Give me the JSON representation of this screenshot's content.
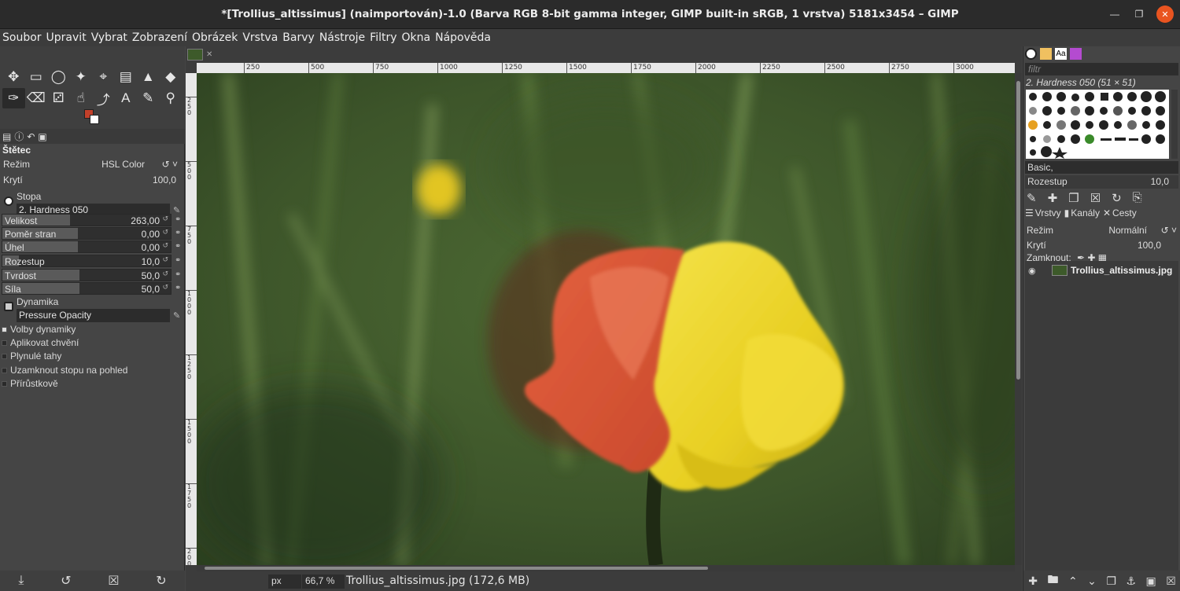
{
  "window": {
    "title": "*[Trollius_altissimus] (naimportován)-1.0 (Barva RGB 8-bit gamma integer, GIMP built-in sRGB, 1 vrstva) 5181x3454 – GIMP"
  },
  "menu": [
    "Soubor",
    "Upravit",
    "Vybrat",
    "Zobrazení",
    "Obrázek",
    "Vrstva",
    "Barvy",
    "Nástroje",
    "Filtry",
    "Okna",
    "Nápověda"
  ],
  "tool_options": {
    "title": "Štětec",
    "mode_label": "Režim",
    "mode_value": "HSL Color",
    "opacity_label": "Krytí",
    "opacity_value": "100,0",
    "brush_label": "Stopa",
    "brush_value": "2. Hardness 050",
    "sliders": [
      {
        "label": "Velikost",
        "value": "263,00",
        "fill": 0.4
      },
      {
        "label": "Poměr stran",
        "value": "0,00",
        "fill": 0.45
      },
      {
        "label": "Úhel",
        "value": "0,00",
        "fill": 0.45
      },
      {
        "label": "Rozestup",
        "value": "10,0",
        "fill": 0.1
      },
      {
        "label": "Tvrdost",
        "value": "50,0",
        "fill": 0.46
      },
      {
        "label": "Síla",
        "value": "50,0",
        "fill": 0.46
      }
    ],
    "dynamics_label": "Dynamika",
    "dynamics_value": "Pressure Opacity",
    "checks": [
      {
        "label": "Volby dynamiky",
        "on": true
      },
      {
        "label": "Aplikovat chvění",
        "on": false
      },
      {
        "label": "Plynulé tahy",
        "on": false
      },
      {
        "label": "Uzamknout stopu na pohled",
        "on": false
      },
      {
        "label": "Přírůstkově",
        "on": false
      }
    ]
  },
  "ruler": {
    "h_ticks": [
      "250",
      "500",
      "750",
      "1000",
      "1250",
      "1500",
      "1750",
      "2000",
      "2250",
      "2500",
      "2750",
      "3000"
    ],
    "v_ticks": [
      "2 5 0",
      "5 0 0",
      "7 5 0",
      "1 0 0 0",
      "1 2 5 0",
      "1 5 0 0",
      "1 7 5 0",
      "2 0 0 0",
      "2 2 5 0"
    ]
  },
  "status": {
    "unit": "px",
    "zoom": "66,7 %",
    "info": "Trollius_altissimus.jpg (172,6 MB)"
  },
  "brushes_panel": {
    "filter_placeholder": "filtr",
    "selected": "2. Hardness 050 (51 × 51)",
    "preset": "Basic,",
    "spacing_label": "Rozestup",
    "spacing_value": "10,0"
  },
  "layers_panel": {
    "tabs": [
      "Vrstvy",
      "Kanály",
      "Cesty"
    ],
    "mode_label": "Režim",
    "mode_value": "Normální",
    "opacity_label": "Krytí",
    "opacity_value": "100,0",
    "lock_label": "Zamknout:",
    "layer_name": "Trollius_altissimus.jpg"
  }
}
